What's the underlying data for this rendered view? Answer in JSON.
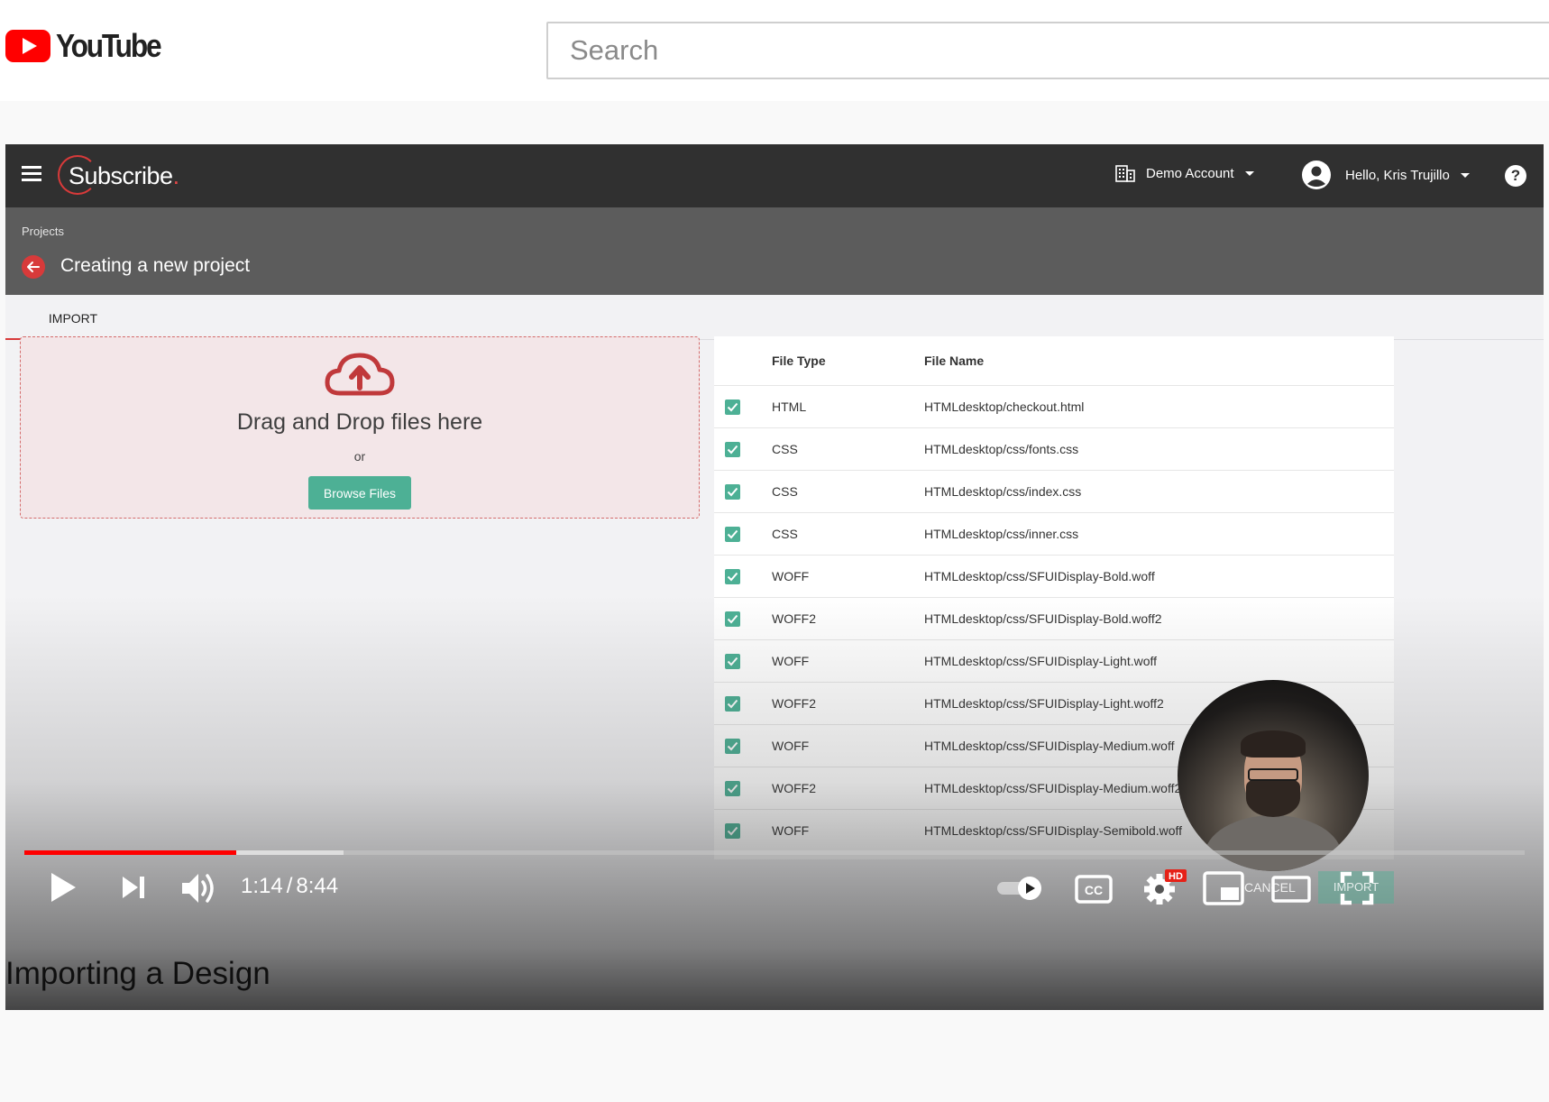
{
  "youtube": {
    "logo_text": "YouTube",
    "search_placeholder": "Search"
  },
  "app": {
    "brand_name": "Subscribe",
    "brand_dot": ".",
    "account_label": "Demo Account",
    "user_greeting": "Hello, Kris Trujillo",
    "help_symbol": "?",
    "breadcrumb": "Projects",
    "page_title": "Creating a new project",
    "tab_import": "IMPORT",
    "dropzone": {
      "title": "Drag and Drop files here",
      "or": "or",
      "browse_label": "Browse Files"
    },
    "table": {
      "col_type": "File Type",
      "col_name": "File Name",
      "rows": [
        {
          "type": "HTML",
          "name": "HTMLdesktop/checkout.html",
          "checked": true
        },
        {
          "type": "CSS",
          "name": "HTMLdesktop/css/fonts.css",
          "checked": true
        },
        {
          "type": "CSS",
          "name": "HTMLdesktop/css/index.css",
          "checked": true
        },
        {
          "type": "CSS",
          "name": "HTMLdesktop/css/inner.css",
          "checked": true
        },
        {
          "type": "WOFF",
          "name": "HTMLdesktop/css/SFUIDisplay-Bold.woff",
          "checked": true
        },
        {
          "type": "WOFF2",
          "name": "HTMLdesktop/css/SFUIDisplay-Bold.woff2",
          "checked": true
        },
        {
          "type": "WOFF",
          "name": "HTMLdesktop/css/SFUIDisplay-Light.woff",
          "checked": true
        },
        {
          "type": "WOFF2",
          "name": "HTMLdesktop/css/SFUIDisplay-Light.woff2",
          "checked": true
        },
        {
          "type": "WOFF",
          "name": "HTMLdesktop/css/SFUIDisplay-Medium.woff",
          "checked": true
        },
        {
          "type": "WOFF2",
          "name": "HTMLdesktop/css/SFUIDisplay-Medium.woff2",
          "checked": true
        },
        {
          "type": "WOFF",
          "name": "HTMLdesktop/css/SFUIDisplay-Semibold.woff",
          "checked": true
        }
      ]
    },
    "ghost_cancel": "CANCEL",
    "ghost_import": "IMPORT"
  },
  "player": {
    "current_time": "1:14",
    "time_separator": "/",
    "duration": "8:44",
    "played_fraction": 0.141,
    "buffered_fraction": 0.213,
    "hd_badge": "HD",
    "cc_label": "CC"
  },
  "video_title": "Importing a Design",
  "colors": {
    "yt_red": "#ff0000",
    "app_header": "#303030",
    "sub_header": "#5c5c5c",
    "accent_red": "#d83a3a",
    "accent_green": "#4db095"
  },
  "icons": [
    "youtube-play-icon",
    "hamburger-icon",
    "building-icon",
    "caret-down-icon",
    "account-circle-icon",
    "help-icon",
    "back-arrow-icon",
    "cloud-upload-icon",
    "checkbox-checked-icon",
    "play-icon",
    "next-icon",
    "volume-icon",
    "autoplay-toggle-icon",
    "captions-icon",
    "settings-icon",
    "miniplayer-icon",
    "theater-icon",
    "fullscreen-icon"
  ]
}
